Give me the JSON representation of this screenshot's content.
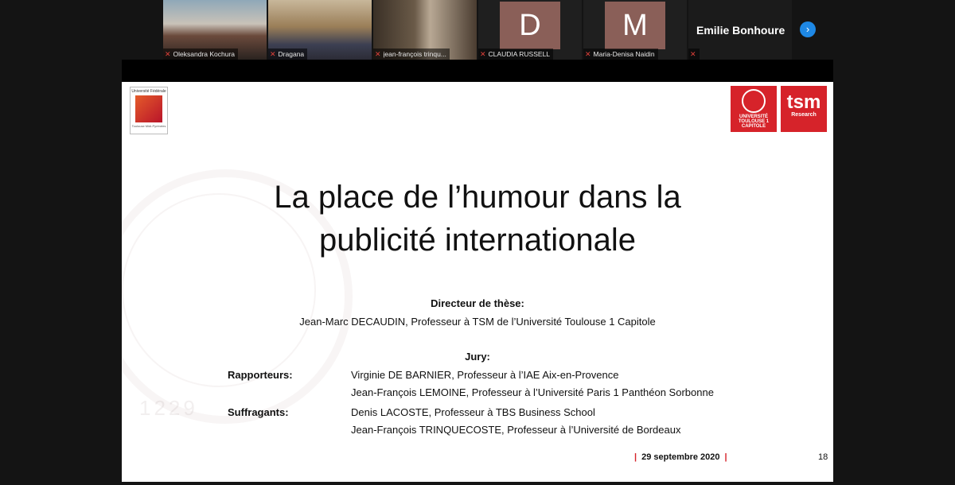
{
  "participants": [
    {
      "name": "Oleksandra Kochura",
      "type": "video"
    },
    {
      "name": "Dragana",
      "type": "video"
    },
    {
      "name": "jean-françois trinqu...",
      "type": "video"
    },
    {
      "name": "CLAUDIA RUSSELL",
      "type": "avatar",
      "letter": "D"
    },
    {
      "name": "Maria-Denisa Naidin",
      "type": "avatar",
      "letter": "M"
    },
    {
      "name": "Emilie Bonhoure",
      "type": "name"
    }
  ],
  "slide": {
    "logo_left_top": "Université Fédérale",
    "logo_left_bottom": "Toulouse Midi-Pyrénées",
    "logo_ut1_text": "UNIVERSITÉ TOULOUSE 1 CAPITOLE",
    "logo_tsm_big": "tsm",
    "logo_tsm_small": "Research",
    "title_line1": "La place de l’humour dans la",
    "title_line2": "publicité internationale",
    "director_heading": "Directeur de thèse:",
    "director": "Jean-Marc DECAUDIN, Professeur à TSM de l’Université Toulouse 1 Capitole",
    "jury_heading": "Jury:",
    "rapporteurs_label": "Rapporteurs:",
    "rapporteur_1": "Virginie DE BARNIER, Professeur à l’IAE Aix-en-Provence",
    "rapporteur_2": "Jean-François LEMOINE, Professeur à l’Université Paris 1 Panthéon Sorbonne",
    "suffragants_label": "Suffragants:",
    "suffragant_1": "Denis LACOSTE, Professeur à TBS Business School",
    "suffragant_2": "Jean-François TRINQUECOSTE, Professeur à l’Université de Bordeaux",
    "date": "29 septembre 2020",
    "page_number": "18",
    "watermark_text": "1229"
  },
  "colors": {
    "accent_red": "#d6232a",
    "next_button": "#1e88e5"
  }
}
